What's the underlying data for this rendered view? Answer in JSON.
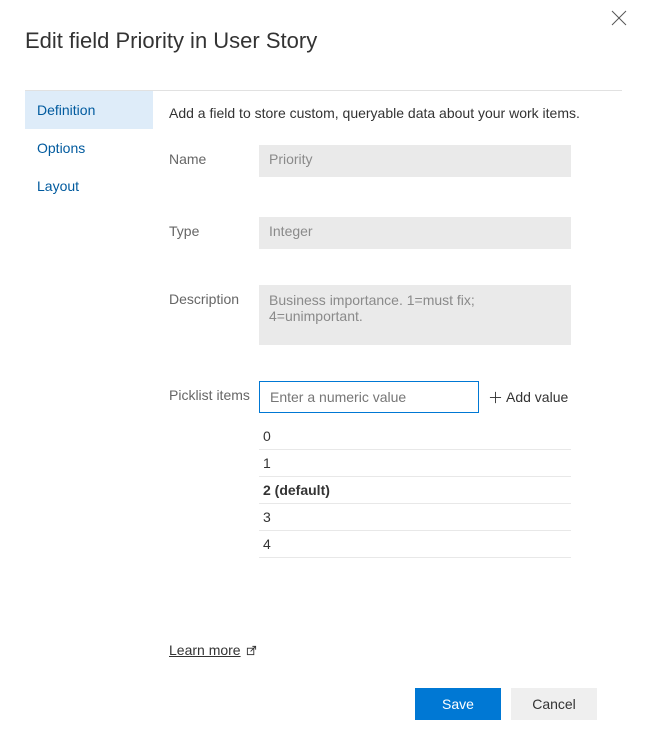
{
  "dialog": {
    "title": "Edit field Priority in User Story"
  },
  "sidebar": {
    "tabs": [
      {
        "label": "Definition",
        "active": true
      },
      {
        "label": "Options",
        "active": false
      },
      {
        "label": "Layout",
        "active": false
      }
    ]
  },
  "main": {
    "intro": "Add a field to store custom, queryable data about your work items.",
    "name_label": "Name",
    "name_value": "Priority",
    "type_label": "Type",
    "type_value": "Integer",
    "desc_label": "Description",
    "desc_value": "Business importance. 1=must fix; 4=unimportant.",
    "picklist_label": "Picklist items",
    "picklist_placeholder": "Enter a numeric value",
    "add_value_label": "Add value",
    "picklist_items": [
      {
        "display": "0",
        "default": false
      },
      {
        "display": "1",
        "default": false
      },
      {
        "display": "2 (default)",
        "default": true
      },
      {
        "display": "3",
        "default": false
      },
      {
        "display": "4",
        "default": false
      }
    ],
    "learn_more": "Learn more"
  },
  "footer": {
    "save_label": "Save",
    "cancel_label": "Cancel"
  }
}
